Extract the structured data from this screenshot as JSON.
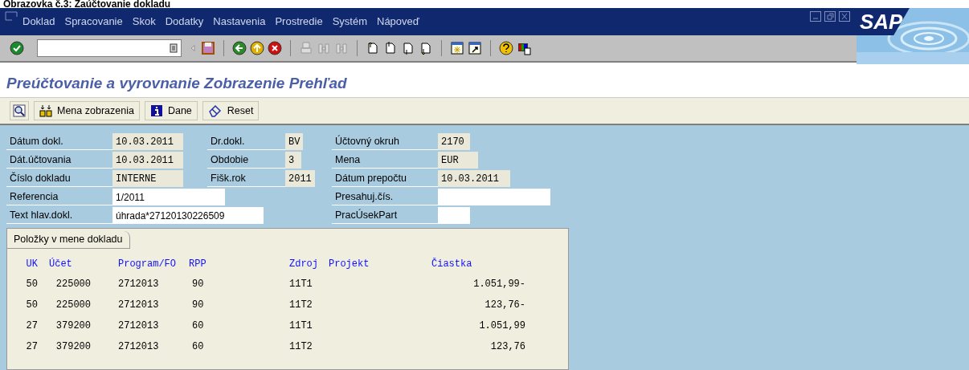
{
  "caption": "Obrazovka č.3: Zaúčtovanie  dokladu",
  "menu": [
    "Doklad",
    "Spracovanie",
    "Skok",
    "Dodatky",
    "Nastavenia",
    "Prostredie",
    "Systém",
    "Nápoveď"
  ],
  "logo": "SAP",
  "title": "Preúčtovanie a vyrovnanie Zobrazenie Prehľad",
  "app_toolbar": [
    {
      "kind": "icon"
    },
    {
      "kind": "button",
      "label": "Mena zobrazenia"
    },
    {
      "kind": "button",
      "label": "Dane"
    },
    {
      "kind": "button",
      "label": "Reset"
    }
  ],
  "header_columns": [
    [
      {
        "label": "Dátum dokl.",
        "value": "10.03.2011",
        "kind": "display"
      },
      {
        "label": "Dát.účtovania",
        "value": "10.03.2011",
        "kind": "display"
      },
      {
        "label": "Číslo dokladu",
        "value": "INTERNE",
        "kind": "display"
      },
      {
        "label": "Referencia",
        "value": "1/2011",
        "kind": "input"
      },
      {
        "label": "Text hlav.dokl.",
        "value": "úhrada*27120130226509",
        "kind": "input"
      }
    ],
    [
      {
        "label": "Dr.dokl.",
        "value": "BV",
        "kind": "display"
      },
      {
        "label": "Obdobie",
        "value": "3",
        "kind": "display"
      },
      {
        "label": "Fišk.rok",
        "value": "2011",
        "kind": "display"
      }
    ],
    [
      {
        "label": "Účtovný okruh",
        "value": "2170",
        "kind": "display"
      },
      {
        "label": "Mena",
        "value": "EUR",
        "kind": "display"
      },
      {
        "label": "Dátum prepočtu",
        "value": "10.03.2011",
        "kind": "display"
      },
      {
        "label": "Presahuj.čís.",
        "kind": "input"
      },
      {
        "label": "PracÚsekPart",
        "kind": "input"
      }
    ]
  ],
  "items_tab": "Položky v mene dokladu",
  "table": {
    "columns": [
      "UK",
      "Účet",
      "Program/FO",
      "RPP",
      "Zdroj",
      "Projekt",
      "Čiastka"
    ],
    "rows": [
      [
        "50",
        "225000",
        "2712013",
        "90",
        "11T1",
        "",
        "1.051,99-"
      ],
      [
        "50",
        "225000",
        "2712013",
        "90",
        "11T2",
        "",
        "123,76-"
      ],
      [
        "27",
        "379200",
        "2712013",
        "60",
        "11T1",
        "",
        "1.051,99"
      ],
      [
        "27",
        "379200",
        "2712013",
        "60",
        "11T2",
        "",
        "123,76"
      ]
    ]
  }
}
